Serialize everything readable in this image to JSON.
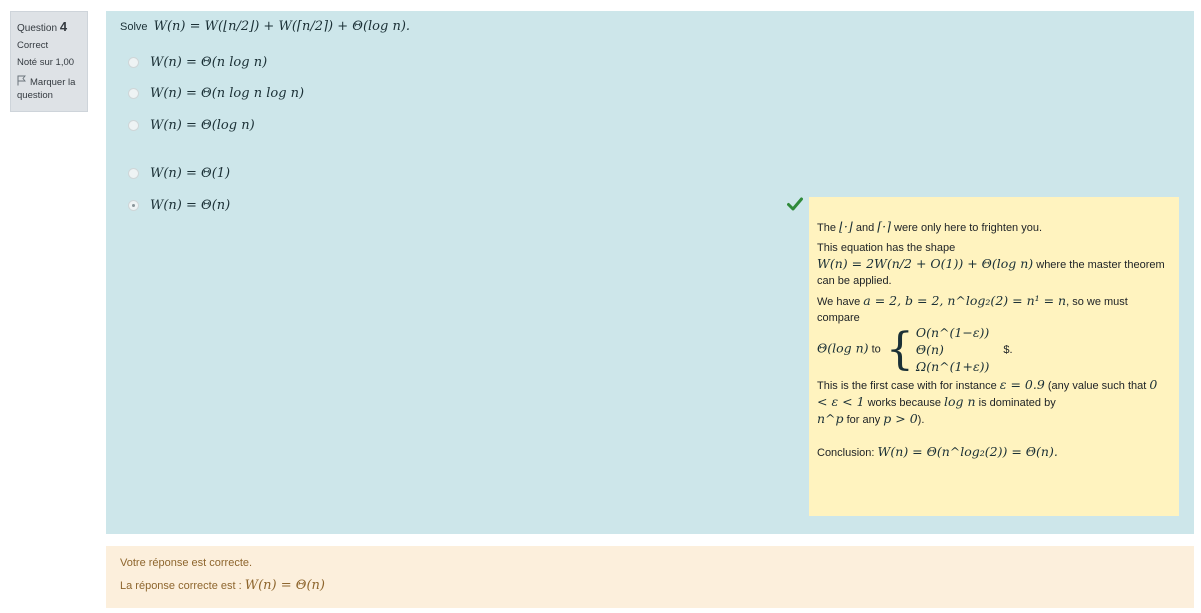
{
  "info": {
    "question_label": "Question",
    "question_number": "4",
    "state": "Correct",
    "grade": "Noté sur 1,00",
    "flag_label": "Marquer la question"
  },
  "question": {
    "prompt_prefix": "Solve",
    "prompt_math": "W(n) = W(⌊n/2⌋) + W(⌈n/2⌉) + Θ(log n)."
  },
  "options": [
    {
      "text": "W(n) = Θ(n log n)",
      "selected": false
    },
    {
      "text": "W(n) = Θ(n log n log n)",
      "selected": false
    },
    {
      "text": "W(n) = Θ(log n)",
      "selected": false
    },
    {
      "text": "W(n) = Θ(1)",
      "selected": false
    },
    {
      "text": "W(n) = Θ(n)",
      "selected": true
    }
  ],
  "feedback": {
    "p1_a": "The",
    "p1_floor": "⌊·⌋",
    "p1_and": "and",
    "p1_ceil": "⌈·⌉",
    "p1_b": "were only here to frighten you.",
    "p2_a": "This equation has the shape",
    "p2_math": "W(n) = 2W(n/2 + O(1)) + Θ(log n)",
    "p2_b": "where the master theorem can be applied.",
    "p3_a": "We have",
    "p3_math": "a = 2, b = 2, n^log₂(2) = n¹ = n",
    "p3_b": ", so we must compare",
    "p3_theta": "Θ(log n)",
    "p3_to": "to",
    "case1": "O(n^(1−ε))",
    "case2": "Θ(n)",
    "case3": "Ω(n^(1+ε))",
    "p3_end": "$.",
    "p4_a": "This is the first case with for instance",
    "p4_eps": "ε = 0.9",
    "p4_b": "(any value such that",
    "p4_range": "0 < ε < 1",
    "p4_c": "works because",
    "p4_log": "log n",
    "p4_d": "is dominated by",
    "p4_np": "n^p",
    "p4_e": "for any",
    "p4_pcond": "p > 0",
    "p4_f": ").",
    "p5_a": "Conclusion:",
    "p5_math": "W(n) = Θ(n^log₂(2)) = Θ(n)."
  },
  "outcome": {
    "message": "Votre réponse est correcte.",
    "right_answer_prefix": "La réponse correcte est :",
    "right_answer": "W(n) = Θ(n)"
  },
  "colors": {
    "content_bg": "#cde6ea",
    "feedback_bg": "#fff3bf",
    "outcome_bg": "#fcefdc",
    "check_green": "#2f8a3a",
    "info_bg": "#dee2e6"
  }
}
